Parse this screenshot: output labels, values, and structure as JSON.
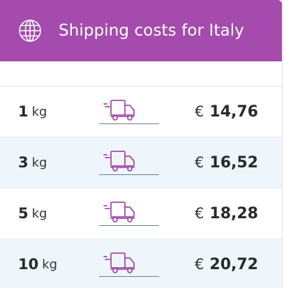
{
  "header": {
    "title": "Shipping costs for Italy",
    "icon": "globe-icon",
    "background": "#a44bad"
  },
  "rates": [
    {
      "weight": "1",
      "unit": "kg",
      "currency": "€",
      "price": "14,76",
      "icon": "delivery-truck-icon"
    },
    {
      "weight": "3",
      "unit": "kg",
      "currency": "€",
      "price": "16,52",
      "icon": "delivery-truck-icon"
    },
    {
      "weight": "5",
      "unit": "kg",
      "currency": "€",
      "price": "18,28",
      "icon": "delivery-truck-icon"
    },
    {
      "weight": "10",
      "unit": "kg",
      "currency": "€",
      "price": "20,72",
      "icon": "delivery-truck-icon"
    }
  ],
  "colors": {
    "accent": "#a44bad",
    "row_alt": "#eef6fb",
    "text": "#2a2a2a"
  }
}
